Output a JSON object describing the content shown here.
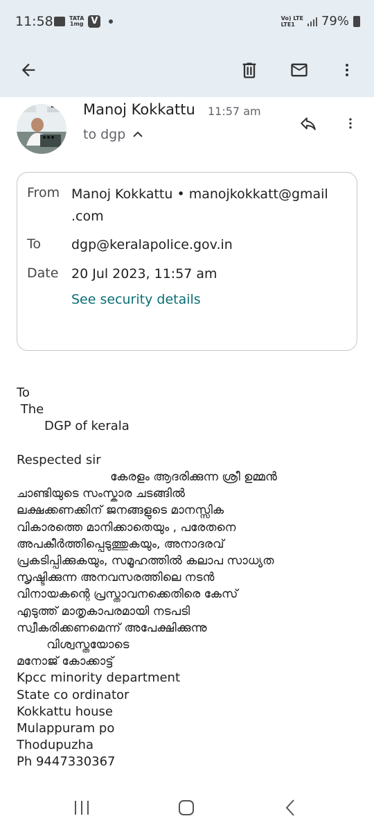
{
  "status_bar": {
    "time": "11:58",
    "tata_label": "TATA",
    "tata_sub": "1mg",
    "v_label": "V",
    "lte_top": "Vo) LTE",
    "lte_bottom": "LTE1",
    "battery": "79%"
  },
  "toolbar": {
    "back_icon": "arrow-left-icon",
    "delete_icon": "trash-icon",
    "mark_unread_icon": "envelope-icon",
    "more_icon": "more-vert-icon"
  },
  "message": {
    "sender_name": "Manoj Kokkattu",
    "time": "11:57 am",
    "to_summary": "to dgp",
    "details": {
      "from_label": "From",
      "from_value_line1": "Manoj Kokkattu • manojkokkatt@gmail",
      "from_value_line2": ".com",
      "to_label": "To",
      "to_value": "dgp@keralapolice.gov.in",
      "date_label": "Date",
      "date_value": "20 Jul 2023, 11:57 am",
      "security_link": "See security details"
    },
    "body_lines": [
      "To",
      " The",
      "       DGP of kerala",
      "",
      "Respected sir",
      "                         കേരളം ആദരിക്കുന്ന ശ്രീ ഉമ്മൻ",
      "ചാണ്ടിയുടെ സംസ്കാര ചടങ്ങിൽ",
      "ലക്ഷക്കണക്കിന് ജനങ്ങളുടെ മാനസ്സിക",
      "വികാരത്തെ മാനിക്കാതെയും , പരേതനെ",
      "അപകീർത്തിപ്പെടുത്തുകയും, അനാദരവ്",
      "പ്രകടിപ്പിക്കുകയും, സമൂഹത്തിൽ കലാപ സാധ്യത",
      "സൃഷ്ടിക്കുന്ന അനവസരത്തിലെ നടൻ",
      "വിനായകന്റെ പ്രസ്താവനക്കെതിരെ കേസ്",
      "എടുത്ത് മാതൃകാപരമായി നടപടി",
      "സ്വീകരിക്കണമെന്ന് അപേക്ഷിക്കുന്നു",
      "        വിശ്വസ്തയോടെ",
      "മനോജ് കോക്കാട്ട്",
      "Kpcc minority department",
      "State co ordinator",
      "Kokkattu house",
      "Mulappuram po",
      "Thodupuzha",
      "Ph 9447330367"
    ]
  },
  "colors": {
    "toolbar_bg": "#e6edf3",
    "link": "#0b6e75",
    "secondary_text": "#5f6368",
    "card_border": "#c4c7c5"
  },
  "nav_bar": {
    "recents_icon": "recents-icon",
    "home_icon": "home-icon",
    "back_icon": "nav-back-icon"
  }
}
